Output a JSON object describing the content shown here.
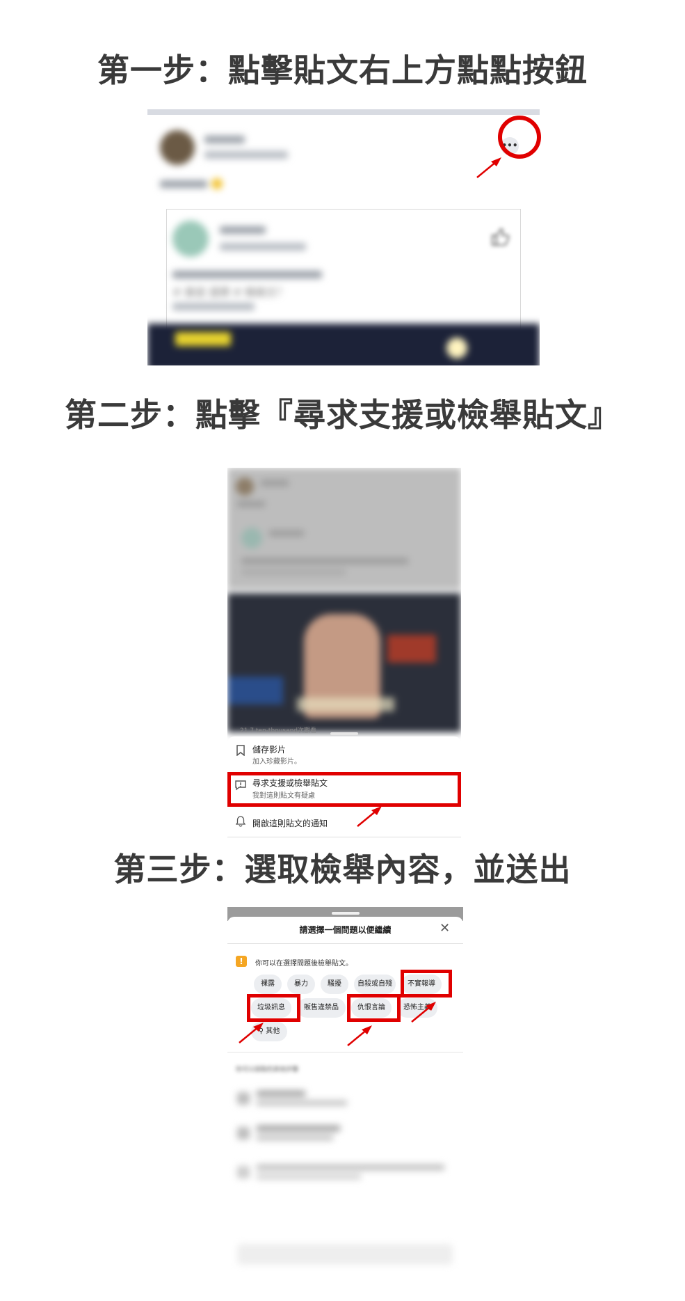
{
  "steps": [
    {
      "heading": "第一步：點擊貼文右上方點點按鈕"
    },
    {
      "heading": "第二步：點擊『尋求支援或檢舉貼文』"
    },
    {
      "heading": "第三步：選取檢舉內容，並送出"
    }
  ],
  "step1": {
    "more_icon": "•••",
    "blurred_text": "# 豪遊 選擇 # 韓美文？"
  },
  "step2": {
    "view_count": "21.7 ten-thousand次觀看",
    "menu": [
      {
        "icon": "bookmark-icon",
        "title": "儲存影片",
        "subtitle": "加入珍藏影片。"
      },
      {
        "icon": "report-icon",
        "title": "尋求支援或檢舉貼文",
        "subtitle": "我對這則貼文有疑慮"
      },
      {
        "icon": "bell-icon",
        "title": "開啟這則貼文的通知",
        "subtitle": ""
      }
    ]
  },
  "step3": {
    "dialog_title": "請選擇一個問題以便繼續",
    "info_text": "你可以在選擇問題後檢舉貼文。",
    "chips": [
      "裸露",
      "暴力",
      "騷擾",
      "自殺或自殘",
      "不實報導",
      "垃圾訊息",
      "販售違禁品",
      "仇恨言論",
      "恐怖主義",
      "其他"
    ],
    "section_label": "你可以採取的其他步驟"
  },
  "colors": {
    "highlight": "#e00000",
    "warning": "#f5a623"
  }
}
